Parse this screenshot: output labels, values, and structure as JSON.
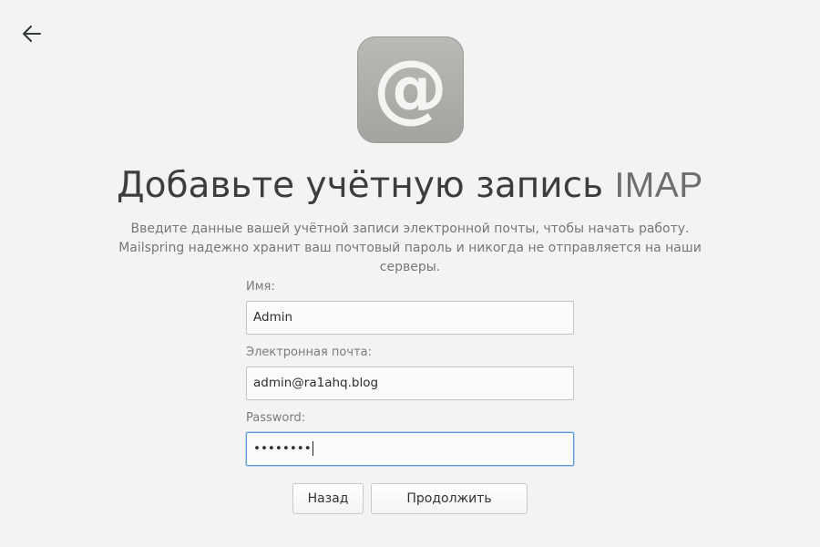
{
  "header": {
    "back_icon": "arrow-left-icon"
  },
  "logo": {
    "icon": "at-sign-icon",
    "glyph": "@"
  },
  "title": {
    "main": "Добавьте учётную запись ",
    "accent": "IMAP"
  },
  "subtitle": "Введите данные вашей учётной записи электронной почты, чтобы начать работу. Mailspring надежно хранит ваш почтовый пароль и никогда не отправляется на наши серверы.",
  "form": {
    "name": {
      "label": "Имя:",
      "value": "Admin"
    },
    "email": {
      "label": "Электронная почта:",
      "value": "admin@ra1ahq.blog"
    },
    "password": {
      "label": "Password:",
      "value": "••••••••"
    }
  },
  "buttons": {
    "back_label": "Назад",
    "continue_label": "Продолжить"
  },
  "colors": {
    "background": "#f2f3f2",
    "focus_border": "#5b9ad7",
    "logo_gray": "#a8a8a5"
  }
}
